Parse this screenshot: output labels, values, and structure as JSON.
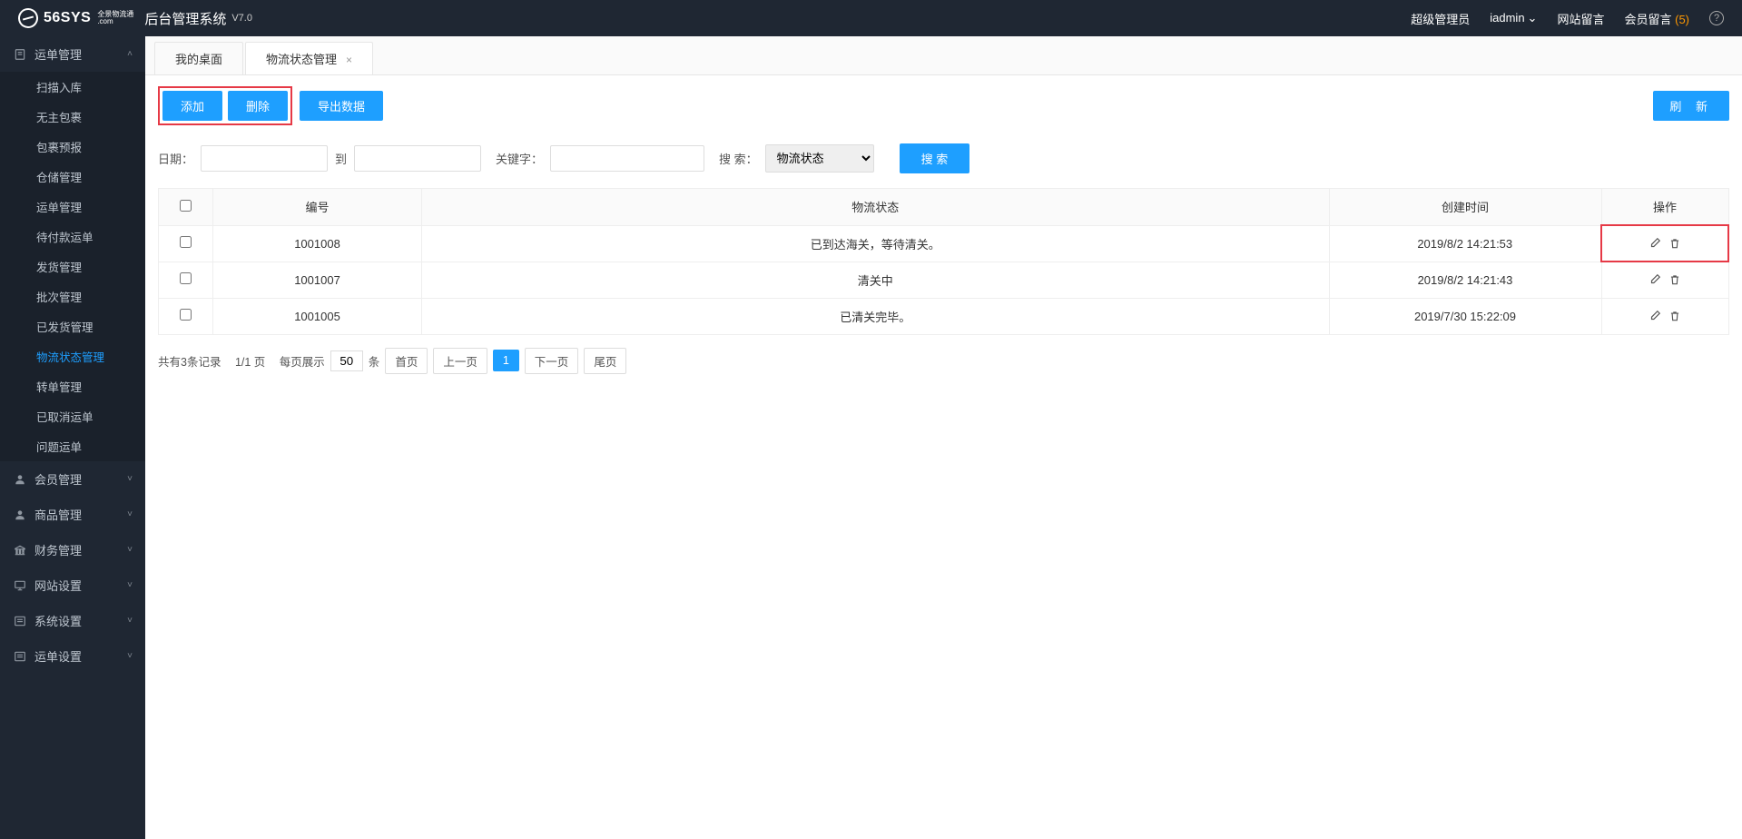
{
  "header": {
    "logo_main": "56SYS",
    "logo_sub": ".com",
    "logo_tag1": "全景物流通",
    "title": "后台管理系统",
    "version": "V7.0",
    "role": "超级管理员",
    "user": "iadmin",
    "site_msg": "网站留言",
    "member_msg": "会员留言",
    "member_msg_count": "(5)"
  },
  "sidebar": {
    "groups": [
      {
        "icon": "document-icon",
        "label": "运单管理",
        "expanded": true,
        "items": [
          "扫描入库",
          "无主包裹",
          "包裹预报",
          "仓储管理",
          "运单管理",
          "待付款运单",
          "发货管理",
          "批次管理",
          "已发货管理",
          "物流状态管理",
          "转单管理",
          "已取消运单",
          "问题运单"
        ],
        "active_index": 9
      },
      {
        "icon": "user-icon",
        "label": "会员管理",
        "expanded": false
      },
      {
        "icon": "user-icon",
        "label": "商品管理",
        "expanded": false
      },
      {
        "icon": "bank-icon",
        "label": "财务管理",
        "expanded": false
      },
      {
        "icon": "monitor-icon",
        "label": "网站设置",
        "expanded": false
      },
      {
        "icon": "list-icon",
        "label": "系统设置",
        "expanded": false
      },
      {
        "icon": "list-icon",
        "label": "运单设置",
        "expanded": false
      }
    ]
  },
  "tabs": [
    {
      "label": "我的桌面",
      "closable": false
    },
    {
      "label": "物流状态管理",
      "closable": true
    }
  ],
  "toolbar": {
    "add": "添加",
    "delete": "删除",
    "export": "导出数据",
    "refresh": "刷 新"
  },
  "filter": {
    "date_label": "日期：",
    "to_label": "到",
    "keyword_label": "关键字：",
    "search_label": "搜 索：",
    "search_select": "物流状态",
    "search_btn": "搜 索"
  },
  "table": {
    "headers": [
      "",
      "编号",
      "物流状态",
      "创建时间",
      "操作"
    ],
    "rows": [
      {
        "id": "1001008",
        "status": "已到达海关，等待清关。",
        "time": "2019/8/2 14:21:53",
        "highlight": true
      },
      {
        "id": "1001007",
        "status": "清关中",
        "time": "2019/8/2 14:21:43",
        "highlight": false
      },
      {
        "id": "1001005",
        "status": "已清关完毕。",
        "time": "2019/7/30 15:22:09",
        "highlight": false
      }
    ]
  },
  "pagination": {
    "total": "共有3条记录",
    "page": "1/1 页",
    "per_page_label": "每页展示",
    "per_page": "50",
    "unit": "条",
    "first": "首页",
    "prev": "上一页",
    "current": "1",
    "next": "下一页",
    "last": "尾页"
  }
}
